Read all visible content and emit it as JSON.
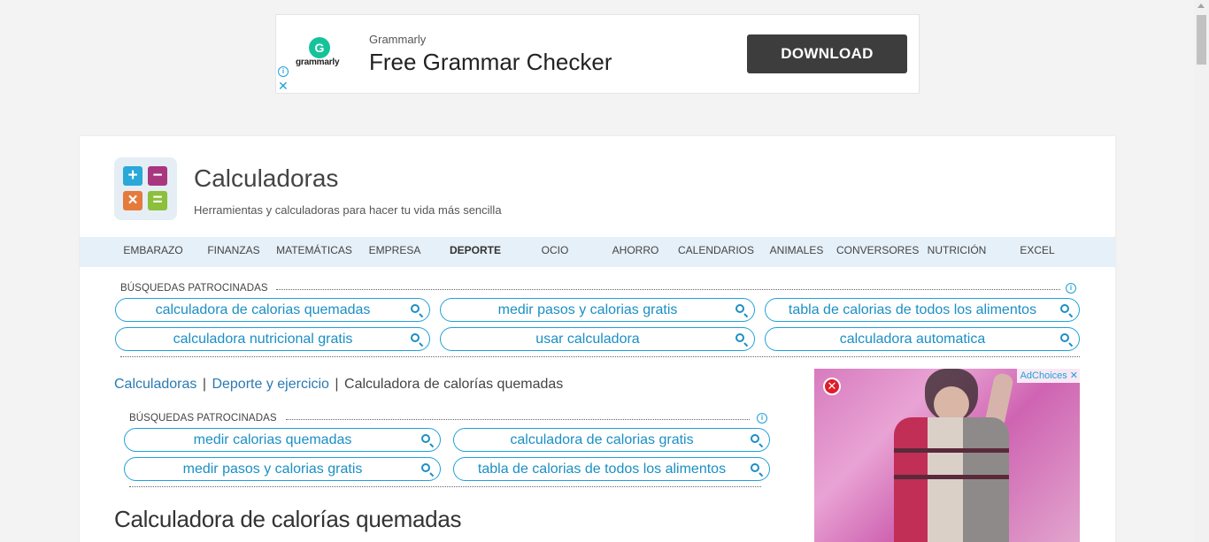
{
  "top_ad": {
    "logo_letter": "G",
    "logo_word": "grammarly",
    "brand": "Grammarly",
    "headline": "Free Grammar Checker",
    "cta": "DOWNLOAD",
    "info_icon": "ⓘ",
    "close_icon": "✕"
  },
  "site": {
    "title": "Calculadoras",
    "subtitle": "Herramientas y calculadoras para hacer tu vida más sencilla",
    "logo_symbols": [
      "+",
      "−",
      "×",
      "="
    ]
  },
  "nav": {
    "items": [
      {
        "label": "EMBARAZO",
        "active": false
      },
      {
        "label": "FINANZAS",
        "active": false
      },
      {
        "label": "MATEMÁTICAS",
        "active": false
      },
      {
        "label": "EMPRESA",
        "active": false
      },
      {
        "label": "DEPORTE",
        "active": true
      },
      {
        "label": "OCIO",
        "active": false
      },
      {
        "label": "AHORRO",
        "active": false
      },
      {
        "label": "CALENDARIOS",
        "active": false
      },
      {
        "label": "ANIMALES",
        "active": false
      },
      {
        "label": "CONVERSORES",
        "active": false
      },
      {
        "label": "NUTRICIÓN",
        "active": false
      },
      {
        "label": "EXCEL",
        "active": false
      }
    ]
  },
  "sponsored_top": {
    "label": "BÚSQUEDAS PATROCINADAS",
    "pills": [
      "calculadora de calorias quemadas",
      "medir pasos y calorias gratis",
      "tabla de calorias de todos los alimentos",
      "calculadora nutricional gratis",
      "usar calculadora",
      "calculadora automatica"
    ]
  },
  "breadcrumb": {
    "items": [
      "Calculadoras",
      "Deporte y ejercicio",
      "Calculadora de calorías quemadas"
    ],
    "separator": "|"
  },
  "sponsored_inner": {
    "label": "BÚSQUEDAS PATROCINADAS",
    "pills": [
      "medir calorias quemadas",
      "calculadora de calorias gratis",
      "medir pasos y calorias gratis",
      "tabla de calorias de todos los alimentos"
    ]
  },
  "page_heading": "Calculadora de calorías quemadas",
  "side_ad": {
    "adchoices": "AdChoices",
    "close_icon": "✕"
  },
  "colors": {
    "accent": "#1fa1d8",
    "nav_bg": "#e6f0f8",
    "page_bg": "#f3f3f3"
  }
}
